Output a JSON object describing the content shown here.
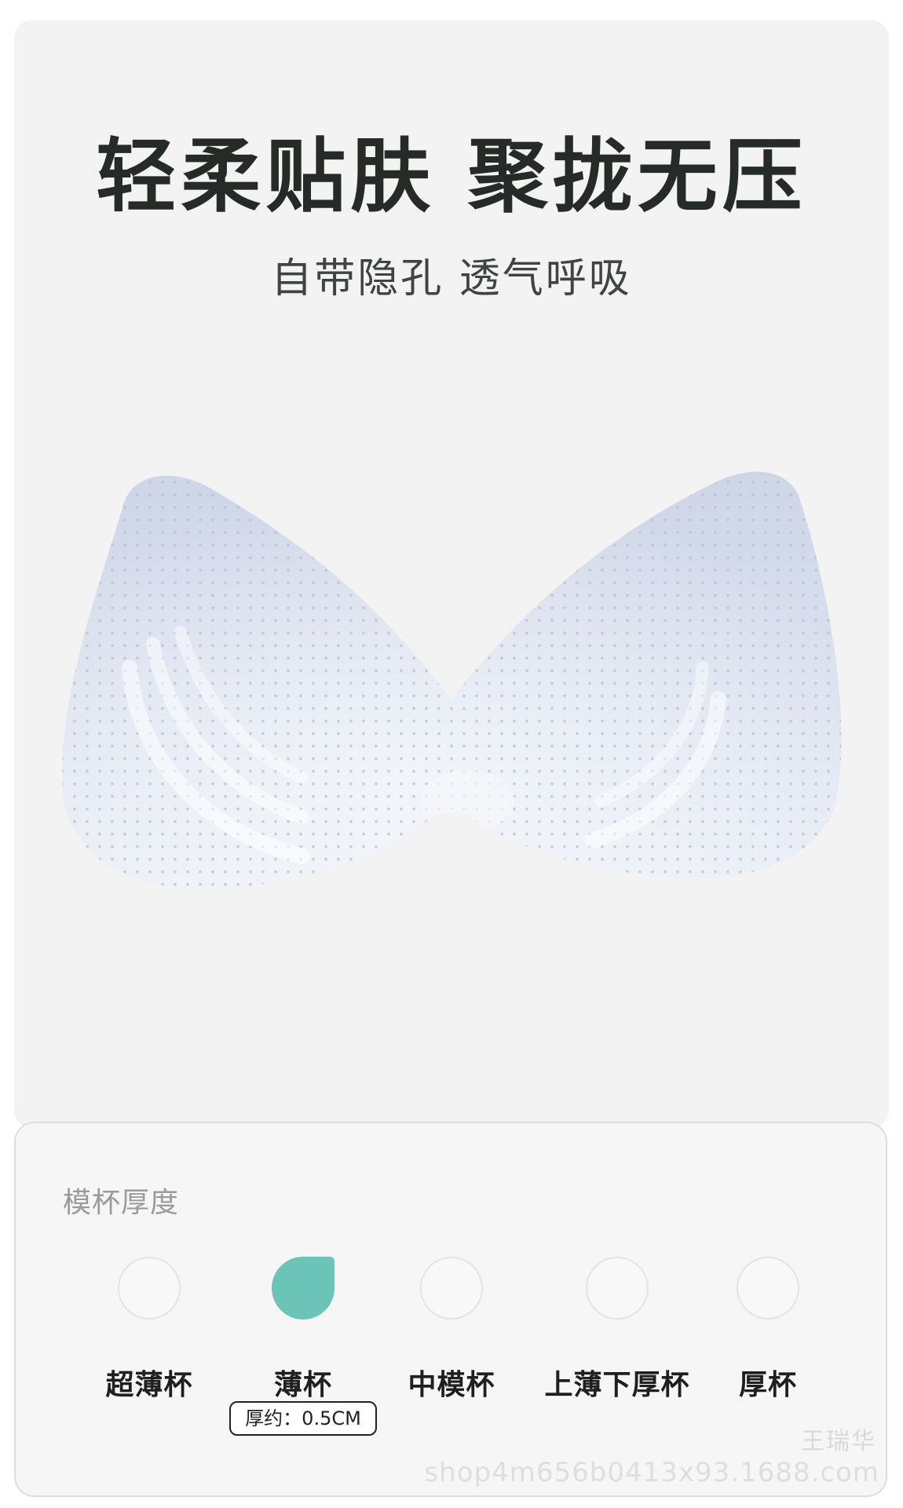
{
  "header": {
    "title": "轻柔贴肤 聚拢无压",
    "subtitle": "自带隐孔 透气呼吸"
  },
  "product": {
    "image": "molded-bra-cup-pad-icon",
    "color": "#dde4f0"
  },
  "thickness": {
    "label": "模杯厚度",
    "options": [
      {
        "label": "超薄杯",
        "selected": false
      },
      {
        "label": "薄杯",
        "selected": true
      },
      {
        "label": "中模杯",
        "selected": false
      },
      {
        "label": "上薄下厚杯",
        "selected": false
      },
      {
        "label": "厚杯",
        "selected": false
      }
    ],
    "spec": "厚约：0.5CM",
    "accent_color": "#6cc4b8"
  },
  "watermark": {
    "name": "王瑞华",
    "url": "shop4m656b0413x93.1688.com"
  }
}
